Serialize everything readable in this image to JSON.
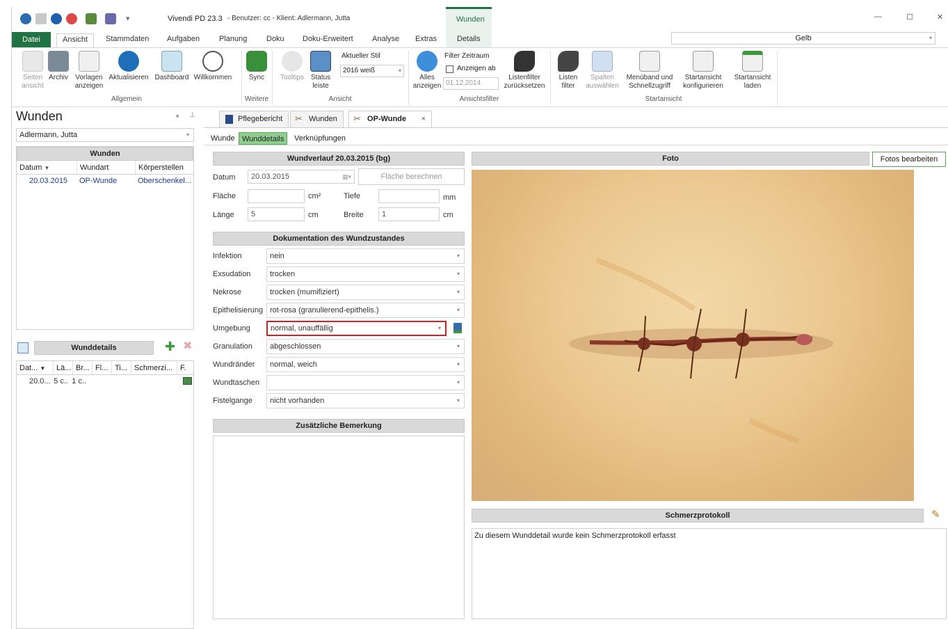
{
  "title": {
    "app": "Vivendi PD 23.3",
    "user": "- Benutzer: cc - Klient: Adlermann, Jutta",
    "context_tab": "Wunden",
    "minimize": "—",
    "maximize": "☐",
    "close": "✕"
  },
  "ribbon_tabs": [
    "Datei",
    "Ansicht",
    "Stammdaten",
    "Aufgaben",
    "Planung",
    "Doku",
    "Doku-Erweitert",
    "Analyse",
    "Extras",
    "Details"
  ],
  "style_field": "Gelb",
  "ribbon": {
    "seiten": "Seiten ansicht",
    "archiv": "Archiv",
    "vorlagen": "Vorlagen anzeigen",
    "aktualisieren": "Aktualisieren",
    "dashboard": "Dashboard",
    "willkommen": "Willkommen",
    "group_allgemein": "Allgemein",
    "sync": "Sync",
    "group_weitere": "Weitere",
    "tooltips": "Tooltips",
    "status": "Status leiste",
    "aktueller_stil": "Aktueller Stil",
    "stil_value": "2016 weiß",
    "group_ansicht": "Ansicht",
    "alles": "Alles anzeigen",
    "filter_zeitraum": "Filter Zeitraum",
    "anzeigen_ab": "Anzeigen ab",
    "date": "01.12.2014",
    "listenfilter_reset": "Listenfilter zurücksetzen",
    "group_ansichtsfilter": "Ansichtsfilter",
    "listen_filter": "Listen filter",
    "spalten": "Spalten auswählen",
    "menueband": "Menüband und Schnellzugriff",
    "startansicht_konf": "Startansicht konfigurieren",
    "startansicht_laden": "Startansicht laden",
    "group_startansicht": "Startansicht"
  },
  "left": {
    "title": "Wunden",
    "client": "Adlermann, Jutta",
    "wunden_header": "Wunden",
    "cols": [
      "Datum",
      "Wundart",
      "Körperstellen"
    ],
    "rows": [
      [
        "20.03.2015",
        "OP-Wunde",
        "Oberschenkel..."
      ]
    ],
    "details_header": "Wunddetails",
    "details_cols": [
      "Dat...",
      "Lä...",
      "Br...",
      "Fl...",
      "Ti...",
      "Schmerzi...",
      "F."
    ],
    "details_rows": [
      [
        "20.0...",
        "5 c...",
        "1 c..."
      ]
    ]
  },
  "doc_tabs": [
    "Pflegebericht",
    "Wunden",
    "OP-Wunde"
  ],
  "sub_tabs": [
    "Wunde",
    "Wunddetails",
    "Verknüpfungen"
  ],
  "form": {
    "verlauf_header": "Wundverlauf 20.03.2015 (bg)",
    "datum_label": "Datum",
    "datum_value": "20.03.2015",
    "flaeche_btn": "Fläche berechnen",
    "flaeche_label": "Fläche",
    "flaeche_unit": "cm²",
    "tiefe_label": "Tiefe",
    "tiefe_unit": "mm",
    "laenge_label": "Länge",
    "laenge_value": "5",
    "laenge_unit": "cm",
    "breite_label": "Breite",
    "breite_value": "1",
    "breite_unit": "cm",
    "doku_header": "Dokumentation des Wundzustandes",
    "fields": [
      {
        "label": "Infektion",
        "value": "nein"
      },
      {
        "label": "Exsudation",
        "value": "trocken"
      },
      {
        "label": "Nekrose",
        "value": "trocken (mumifiziert)"
      },
      {
        "label": "Epithelisierung",
        "value": "rot-rosa (granulierend-epithelis.)"
      },
      {
        "label": "Umgebung",
        "value": "normal, unauffällig"
      },
      {
        "label": "Granulation",
        "value": "abgeschlossen"
      },
      {
        "label": "Wundränder",
        "value": "normal, weich"
      },
      {
        "label": "Wundtaschen",
        "value": ""
      },
      {
        "label": "Fistelgange",
        "value": "nicht vorhanden"
      }
    ],
    "bemerkung_header": "Zusätzliche Bemerkung"
  },
  "foto": {
    "header": "Foto",
    "edit_btn": "Fotos bearbeiten",
    "schmerz_header": "Schmerzprotokoll",
    "schmerz_text": "Zu diesem Wunddetail wurde kein Schmerzprotokoll erfasst"
  },
  "colors": {
    "accent_green": "#217346",
    "highlight_red": "#cc2222"
  }
}
